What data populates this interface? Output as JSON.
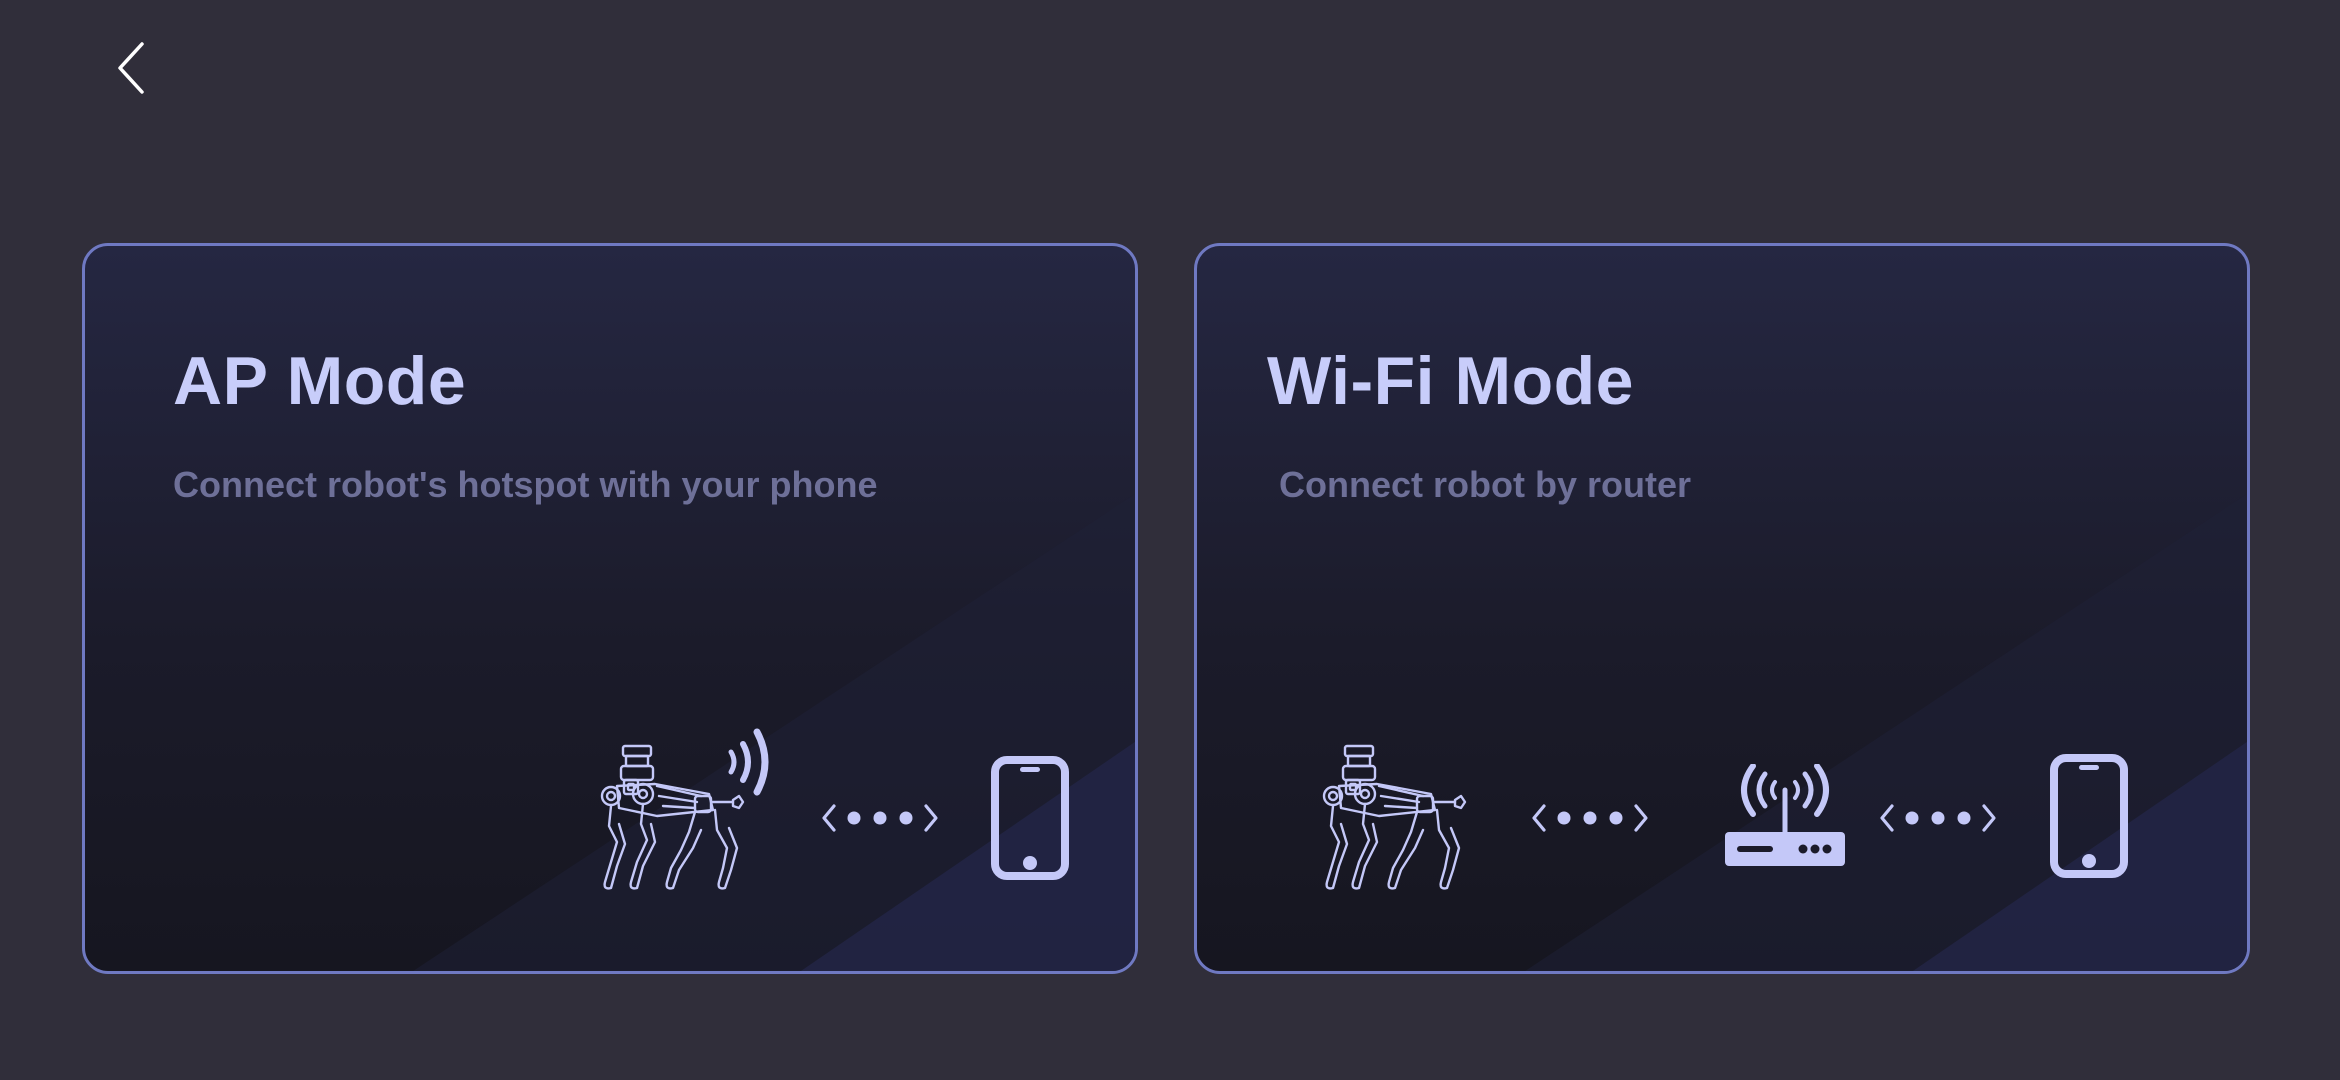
{
  "nav": {
    "back_icon": "chevron-left-icon"
  },
  "colors": {
    "background": "#302e3a",
    "card_border": "#6f79c2",
    "title": "#c8cdfa",
    "description": "#6e7098",
    "icon": "#c4c8f8"
  },
  "cards": [
    {
      "title": "AP Mode",
      "description": "Connect robot's hotspot with your phone",
      "icons": [
        "robot-dog-icon",
        "wireless-signal-icon",
        "bidirectional-dots-icon",
        "smartphone-icon"
      ]
    },
    {
      "title": "Wi-Fi Mode",
      "description": "Connect robot by router",
      "icons": [
        "robot-dog-icon",
        "bidirectional-dots-icon",
        "router-icon",
        "bidirectional-dots-icon",
        "smartphone-icon"
      ]
    }
  ]
}
